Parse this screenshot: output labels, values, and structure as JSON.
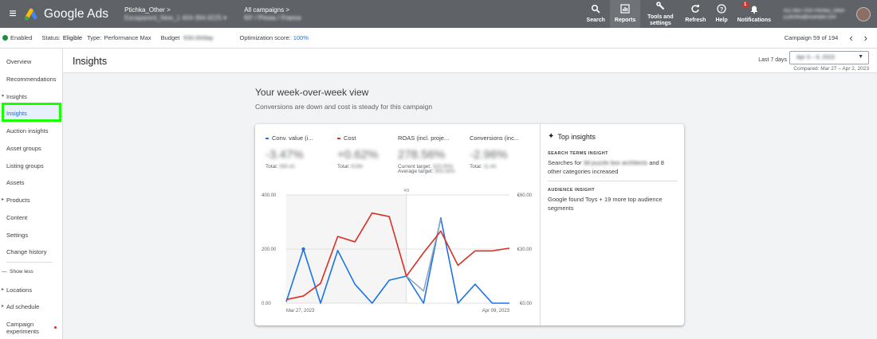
{
  "topbar": {
    "app_name": "Google Ads",
    "account_name": "Ptichka_Other",
    "account_sub": "Escaparent_New_1 404-394-9225",
    "campaigns_label": "All campaigns",
    "campaigns_sub": "NY / Prices / France",
    "actions": [
      {
        "label": "Search",
        "icon": "search-icon"
      },
      {
        "label": "Reports",
        "icon": "reports-icon"
      },
      {
        "label": "Tools and settings",
        "icon": "wrench-icon"
      },
      {
        "label": "Refresh",
        "icon": "refresh-icon"
      },
      {
        "label": "Help",
        "icon": "help-icon"
      },
      {
        "label": "Notifications",
        "icon": "bell-icon",
        "badge": "1"
      }
    ],
    "user_line1": "911-963-7000 Ptichka_Other",
    "user_line2": "p.ptichka@example.com"
  },
  "status": {
    "state": "Enabled",
    "status_label": "Status:",
    "status_value": "Eligible",
    "type_label": "Type:",
    "type_value": "Performance Max",
    "budget_label": "Budget",
    "budget_value": "€30.00/day",
    "opt_label": "Optimization score:",
    "opt_value": "100%",
    "campaign_counter": "Campaign 59 of 194"
  },
  "sidebar": {
    "items": [
      {
        "label": "Overview",
        "kind": "plain"
      },
      {
        "label": "Recommendations",
        "kind": "plain"
      },
      {
        "label": "Insights",
        "kind": "open"
      },
      {
        "label": "Insights",
        "kind": "selected"
      },
      {
        "label": "Auction insights",
        "kind": "plain"
      },
      {
        "label": "Asset groups",
        "kind": "plain"
      },
      {
        "label": "Listing groups",
        "kind": "plain"
      },
      {
        "label": "Assets",
        "kind": "plain"
      },
      {
        "label": "Products",
        "kind": "tri"
      },
      {
        "label": "Content",
        "kind": "plain"
      },
      {
        "label": "Settings",
        "kind": "plain"
      },
      {
        "label": "Change history",
        "kind": "plain"
      },
      {
        "label": "Show less",
        "kind": "less"
      },
      {
        "label": "Locations",
        "kind": "tri"
      },
      {
        "label": "Ad schedule",
        "kind": "tri"
      },
      {
        "label": "Campaign experiments",
        "kind": "plain"
      }
    ]
  },
  "page": {
    "title": "Insights",
    "date_label": "Last 7 days",
    "date_value": "Apr 3 – 9, 2023",
    "compared": "Compared: Mar 27 – Apr 2, 2023",
    "wow_title": "Your week-over-week view",
    "wow_sub": "Conversions are down and cost is steady for this campaign"
  },
  "metrics": [
    {
      "name": "Conv. value (i...",
      "color": "#1a73e8",
      "big": "-3.47%",
      "foot1": "Total:",
      "foot1b": "560.41"
    },
    {
      "name": "Cost",
      "color": "#d93025",
      "big": "+0.62%",
      "foot1": "Total:",
      "foot1b": "€194"
    },
    {
      "name": "ROAS (incl. proje...",
      "color": "",
      "big": "278.56%",
      "foot1": "Current target:",
      "foot1b": "320.00%",
      "foot2": "Average target:",
      "foot2b": "303.33%"
    },
    {
      "name": "Conversions (inc...",
      "color": "",
      "big": "-2.96%",
      "foot1": "Total:",
      "foot1b": "11.44"
    }
  ],
  "chart_data": {
    "type": "line",
    "x": [
      "Mar 27",
      "Mar 28",
      "Mar 29",
      "Mar 30",
      "Mar 31",
      "Apr 1",
      "Apr 2",
      "Apr 3",
      "Apr 4",
      "Apr 5",
      "Apr 6",
      "Apr 7",
      "Apr 8",
      "Apr 9"
    ],
    "x_tick_labels": [
      "Mar 27, 2023",
      "Apr 09, 2023"
    ],
    "left_axis_ticks": [
      "400.00",
      "200.00",
      "0.00"
    ],
    "right_axis_ticks": [
      "€60.00",
      "€30.00",
      "€0.00"
    ],
    "left_ylim": [
      0,
      400
    ],
    "right_ylim": [
      0,
      60
    ],
    "annotation": "4/9",
    "series": [
      {
        "axis": "left",
        "color": "#1a73e8",
        "values": [
          5,
          200,
          0,
          195,
          70,
          0,
          85,
          100,
          0,
          315,
          0,
          70,
          0,
          0
        ]
      },
      {
        "axis": "left",
        "color": "#8fa6c2",
        "values": [
          null,
          null,
          null,
          null,
          null,
          null,
          null,
          100,
          45,
          310,
          null,
          null,
          null,
          null
        ]
      },
      {
        "axis": "right",
        "color": "#d93025",
        "values": [
          2,
          4,
          11,
          37,
          34,
          50,
          48,
          15,
          28,
          40,
          21,
          29,
          29,
          30.5
        ]
      }
    ],
    "grid": true
  },
  "insights": {
    "title": "Top insights",
    "blocks": [
      {
        "label": "SEARCH TERMS INSIGHT",
        "text_a": "Searches for",
        "text_b": "3d puzzle box architects",
        "text_c": "and 8 other categories increased"
      },
      {
        "label": "AUDIENCE INSIGHT",
        "text_a": "Google found Toys + 19 more top audience segments",
        "text_b": "",
        "text_c": ""
      }
    ]
  }
}
